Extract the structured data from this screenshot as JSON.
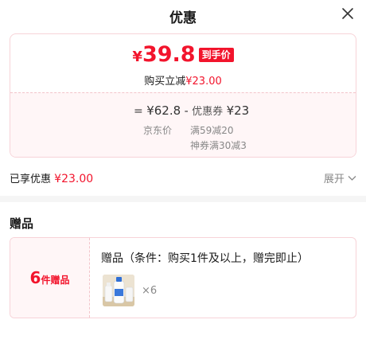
{
  "header": {
    "title": "优惠"
  },
  "price": {
    "currency": "¥",
    "final_price": "39.8",
    "final_tag": "到手价",
    "buy_discount_label": "购买立减",
    "buy_discount_value": "¥23.00",
    "calc_equals": "=",
    "original_price": "¥62.8",
    "calc_minus": "-",
    "coupon_label": "优惠券",
    "coupon_value": "¥23",
    "original_label": "京东价",
    "coupon_details": [
      "满59减20",
      "神券满30减3"
    ]
  },
  "enjoy": {
    "label": "已享优惠",
    "value": "¥23.00",
    "expand_label": "展开"
  },
  "gift": {
    "section_title": "赠品",
    "count": "6",
    "count_label": "件赠品",
    "condition": "赠品（条件：购买1件及以上，赠完即止）",
    "quantity": "×6"
  },
  "colors": {
    "accent": "#f2142c",
    "card_border": "#f7d3d8",
    "card_bg": "#fff6f7",
    "muted": "#888888"
  },
  "icons": {
    "close": "close-icon",
    "expand": "chevron-down-icon",
    "gift_image": "milk-bottle-product-image"
  }
}
